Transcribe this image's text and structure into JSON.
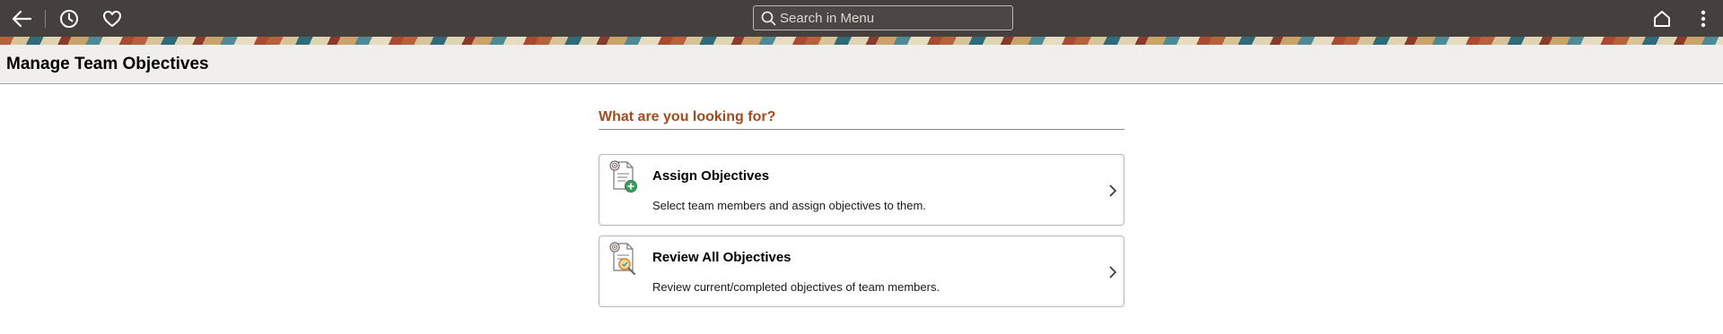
{
  "topbar": {
    "back_icon": "back-arrow-icon",
    "recent_icon": "clock-icon",
    "favorites_icon": "heart-icon",
    "search": {
      "placeholder": "Search in Menu",
      "value": ""
    },
    "home_icon": "home-icon",
    "actions_icon": "vertical-ellipsis-icon"
  },
  "page": {
    "title": "Manage Team Objectives"
  },
  "section": {
    "heading": "What are you looking for?",
    "cards": [
      {
        "title": "Assign Objectives",
        "description": "Select team members and assign objectives to them.",
        "icon": "assign-objectives-icon"
      },
      {
        "title": "Review All Objectives",
        "description": "Review current/completed objectives of team members.",
        "icon": "review-objectives-icon"
      }
    ]
  },
  "colors": {
    "topbar": "#45403d",
    "page_header_bg": "#f1efed",
    "heading_accent": "#a24b1d",
    "card_icon_green": "#3a9d5d",
    "card_icon_orange": "#d18a2c"
  }
}
